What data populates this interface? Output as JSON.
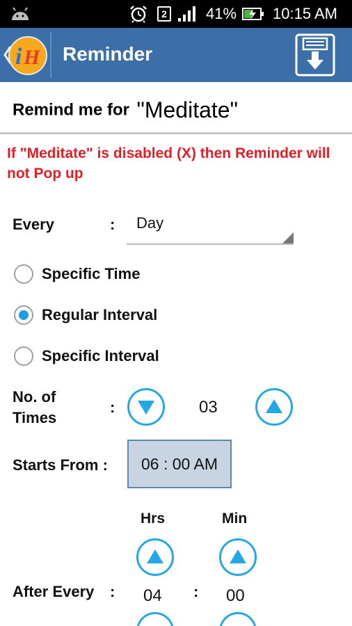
{
  "status_bar": {
    "sim_slot": "2",
    "battery_percent": "41%",
    "time": "10:15 AM",
    "icons": [
      "android-icon",
      "alarm-clock-icon",
      "sim-icon",
      "signal-icon",
      "battery-charging-icon"
    ]
  },
  "app_bar": {
    "title": "Reminder",
    "logo_letters": "iH",
    "colors": {
      "bar": "#3c6fa8",
      "logo": "#f6a91c"
    }
  },
  "header": {
    "prefix": "Remind me for",
    "task_name": "\"Meditate\""
  },
  "warning": "If \"Meditate\" is disabled (X) then Reminder will not Pop up",
  "form": {
    "every_label": "Every",
    "colon": ":",
    "every_value": "Day",
    "radios": [
      {
        "label": "Specific Time",
        "checked": false
      },
      {
        "label": "Regular Interval",
        "checked": true
      },
      {
        "label": "Specific Interval",
        "checked": false
      }
    ],
    "times_label_line1": "No. of",
    "times_label_line2": "Times",
    "times_value": "03",
    "starts_label": "Starts From :",
    "starts_value": "06 : 00 AM",
    "hrs_label": "Hrs",
    "min_label": "Min",
    "after_every_label": "After Every",
    "hrs_value": "04",
    "min_value": "00"
  },
  "colors": {
    "warning": "#e01f26",
    "accent": "#23a7e5",
    "radio_checked": "#1ba1e2",
    "time_box": "#c9d4e2"
  }
}
